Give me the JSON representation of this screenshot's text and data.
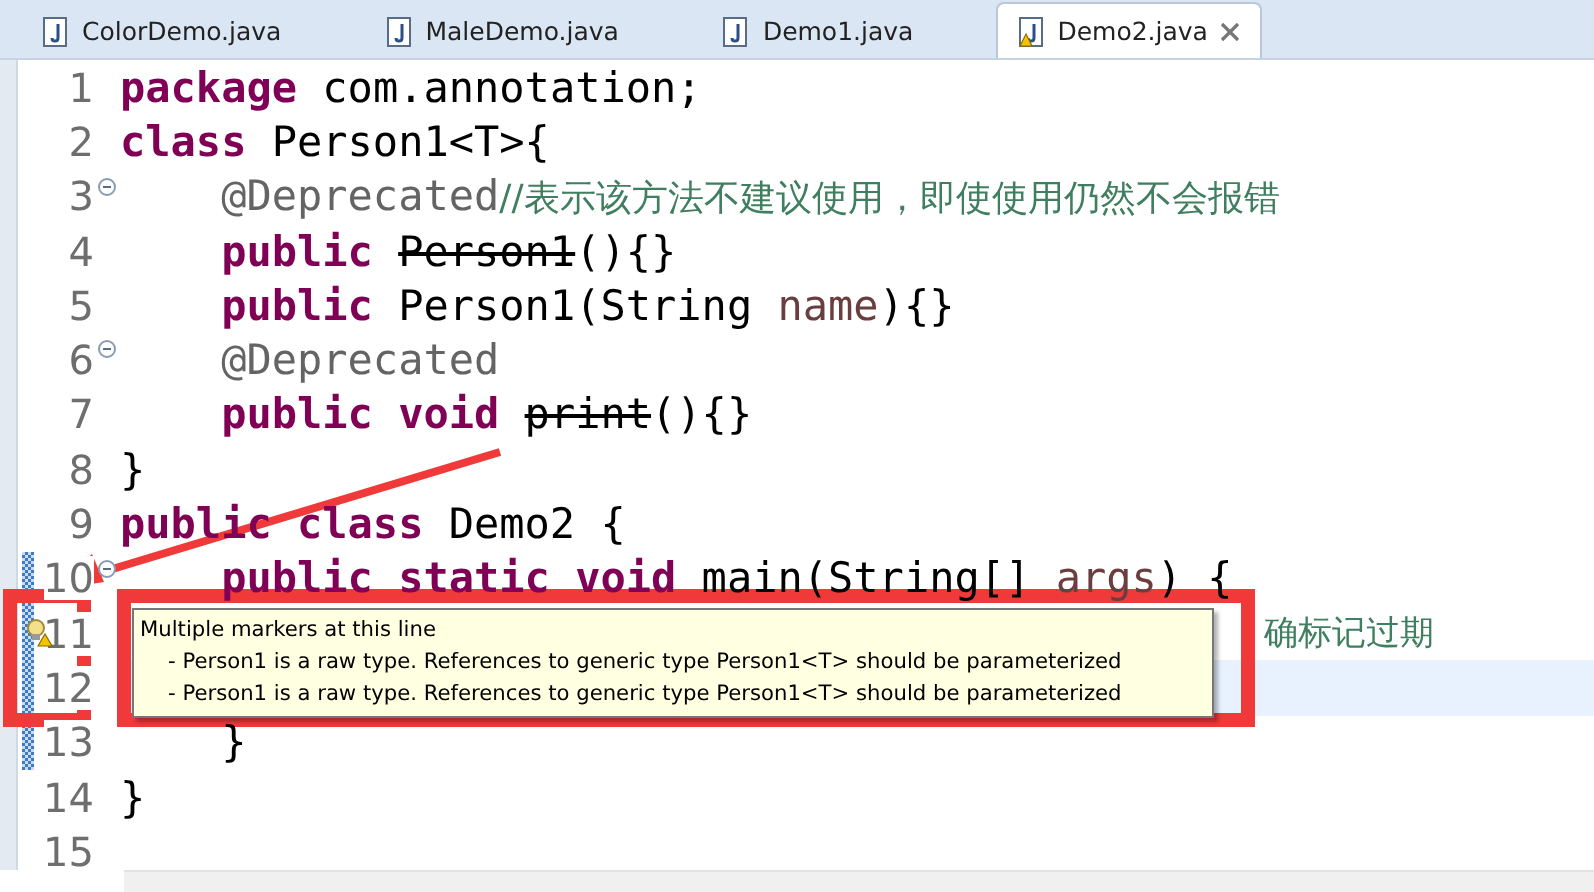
{
  "tabs": [
    {
      "label": "ColorDemo.java",
      "selected": false,
      "warning": false
    },
    {
      "label": "MaleDemo.java",
      "selected": false,
      "warning": false
    },
    {
      "label": "Demo1.java",
      "selected": false,
      "warning": false
    },
    {
      "label": "Demo2.java",
      "selected": true,
      "warning": true
    }
  ],
  "lines": [
    {
      "number": "1",
      "fold": false,
      "changed": false,
      "current": false,
      "warning": false,
      "tokens": [
        {
          "kind": "keyword",
          "text": "package"
        },
        {
          "kind": "plain",
          "text": " com.annotation;"
        }
      ]
    },
    {
      "number": "2",
      "fold": false,
      "changed": false,
      "current": false,
      "warning": false,
      "tokens": [
        {
          "kind": "keyword",
          "text": "class"
        },
        {
          "kind": "plain",
          "text": " Person1<T>{"
        }
      ]
    },
    {
      "number": "3",
      "fold": true,
      "changed": false,
      "current": false,
      "warning": false,
      "tokens": [
        {
          "kind": "annotation",
          "text": "    @Deprecated"
        },
        {
          "kind": "comment",
          "text": "//表示该方法不建议使用，即使使用仍然不会报错"
        }
      ]
    },
    {
      "number": "4",
      "fold": false,
      "changed": false,
      "current": false,
      "warning": false,
      "tokens": [
        {
          "kind": "keyword",
          "text": "    public "
        },
        {
          "kind": "deprecated",
          "text": "Person1"
        },
        {
          "kind": "plain",
          "text": "(){}"
        }
      ]
    },
    {
      "number": "5",
      "fold": false,
      "changed": false,
      "current": false,
      "warning": false,
      "tokens": [
        {
          "kind": "keyword",
          "text": "    public"
        },
        {
          "kind": "plain",
          "text": " Person1(String "
        },
        {
          "kind": "variable",
          "text": "name"
        },
        {
          "kind": "plain",
          "text": "){}"
        }
      ]
    },
    {
      "number": "6",
      "fold": true,
      "changed": false,
      "current": false,
      "warning": false,
      "tokens": [
        {
          "kind": "annotation",
          "text": "    @Deprecated"
        }
      ]
    },
    {
      "number": "7",
      "fold": false,
      "changed": false,
      "current": false,
      "warning": false,
      "tokens": [
        {
          "kind": "keyword",
          "text": "    public void "
        },
        {
          "kind": "deprecated",
          "text": "print"
        },
        {
          "kind": "plain",
          "text": "(){}"
        }
      ]
    },
    {
      "number": "8",
      "fold": false,
      "changed": false,
      "current": false,
      "warning": false,
      "tokens": [
        {
          "kind": "plain",
          "text": "}"
        }
      ]
    },
    {
      "number": "9",
      "fold": false,
      "changed": false,
      "current": false,
      "warning": false,
      "tokens": [
        {
          "kind": "keyword",
          "text": "public class"
        },
        {
          "kind": "plain",
          "text": " Demo2 {"
        }
      ]
    },
    {
      "number": "10",
      "fold": true,
      "changed": true,
      "current": false,
      "warning": false,
      "tokens": [
        {
          "kind": "keyword",
          "text": "    public static void"
        },
        {
          "kind": "plain",
          "text": " main(String[] "
        },
        {
          "kind": "variable",
          "text": "args"
        },
        {
          "kind": "plain",
          "text": ") {"
        }
      ]
    },
    {
      "number": "11",
      "fold": false,
      "changed": true,
      "current": false,
      "warning": true,
      "tokens": [
        {
          "kind": "hidden-comment",
          "text": "确标记过期"
        }
      ]
    },
    {
      "number": "12",
      "fold": false,
      "changed": true,
      "current": true,
      "warning": false
    },
    {
      "number": "13",
      "fold": false,
      "changed": true,
      "current": false,
      "warning": false,
      "tokens": [
        {
          "kind": "plain",
          "text": "    }"
        }
      ]
    },
    {
      "number": "14",
      "fold": false,
      "changed": false,
      "current": false,
      "warning": false,
      "tokens": [
        {
          "kind": "plain",
          "text": "}"
        }
      ]
    },
    {
      "number": "15",
      "fold": false,
      "changed": false,
      "current": false,
      "warning": false
    }
  ],
  "tooltip": {
    "title": "Multiple markers at this line",
    "items": [
      "- Person1 is a raw type. References to generic type Person1<T> should be parameterized",
      "- Person1 is a raw type. References to generic type Person1<T> should be parameterized"
    ]
  }
}
